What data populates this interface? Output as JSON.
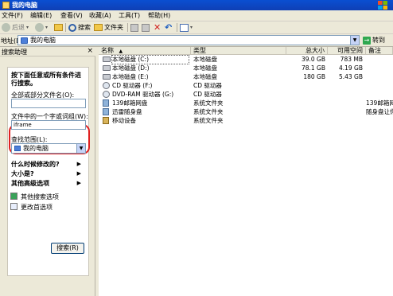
{
  "window": {
    "title": "我的电脑"
  },
  "menu": [
    "文件(F)",
    "编辑(E)",
    "查看(V)",
    "收藏(A)",
    "工具(T)",
    "帮助(H)"
  ],
  "toolbar": {
    "back": "后退",
    "search": "搜索",
    "folders": "文件夹"
  },
  "address": {
    "label": "地址(D)",
    "value": "我的电脑",
    "go": "转到"
  },
  "search_pane": {
    "header": "搜索助理",
    "close": "×",
    "heading": "按下面任意或所有条件进行搜索。",
    "heading_line1": "按下面任意或所有条件进",
    "heading_line2": "行搜索。",
    "name_label": "全部或部分文件名(O):",
    "name_value": "",
    "word_label": "文件中的一个字或词组(W):",
    "word_value": "iframe",
    "look_in_label": "查找范围(L):",
    "look_in_value": "我的电脑",
    "opt_when": "什么时候修改的?",
    "opt_size": "大小是?",
    "opt_advanced": "其他高级选项",
    "link_other": "其他搜索选项",
    "link_prefs": "更改首选项",
    "search_button": "搜索(R)"
  },
  "columns": {
    "name": "名称",
    "type": "类型",
    "total": "总大小",
    "free": "可用空间",
    "comment": "备注"
  },
  "rows": [
    {
      "icon": "hard-drive-icon",
      "name": "本地磁盘 (C:)",
      "type": "本地磁盘",
      "total": "39.0 GB",
      "free": "783 MB",
      "comment": ""
    },
    {
      "icon": "hard-drive-icon",
      "name": "本地磁盘 (D:)",
      "type": "本地磁盘",
      "total": "78.1 GB",
      "free": "4.19 GB",
      "comment": ""
    },
    {
      "icon": "hard-drive-icon",
      "name": "本地磁盘 (E:)",
      "type": "本地磁盘",
      "total": "180 GB",
      "free": "5.43 GB",
      "comment": ""
    },
    {
      "icon": "cd-drive-icon",
      "name": "CD 驱动器 (F:)",
      "type": "CD 驱动器",
      "total": "",
      "free": "",
      "comment": ""
    },
    {
      "icon": "cd-drive-icon",
      "name": "DVD-RAM 驱动器 (G:)",
      "type": "CD 驱动器",
      "total": "",
      "free": "",
      "comment": ""
    },
    {
      "icon": "device-icon",
      "name": "139邮箱网盘",
      "type": "系统文件夹",
      "total": "",
      "free": "",
      "comment": "139邮箱网"
    },
    {
      "icon": "device-icon",
      "name": "迅雷随身盘",
      "type": "系统文件夹",
      "total": "",
      "free": "",
      "comment": "随身盘让你"
    },
    {
      "icon": "device-icon",
      "name": "移动设备",
      "type": "系统文件夹",
      "total": "",
      "free": "",
      "comment": ""
    }
  ]
}
